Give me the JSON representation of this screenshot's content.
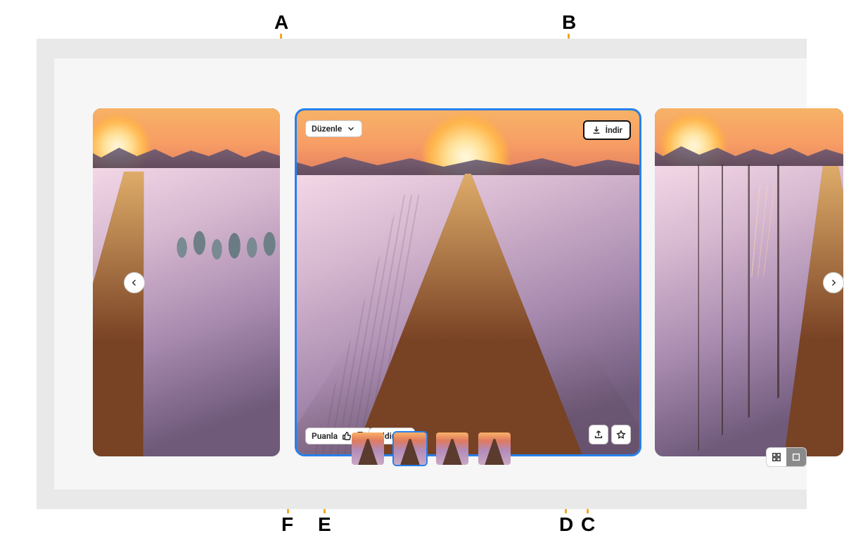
{
  "annotations": {
    "A": "A",
    "B": "B",
    "C": "C",
    "D": "D",
    "E": "E",
    "F": "F"
  },
  "toolbar": {
    "edit_label": "Düzenle",
    "download_label": "İndir",
    "rate_label": "Puanla",
    "report_label": "Bildir"
  },
  "thumbnails": {
    "count": 4,
    "selected_index": 1
  },
  "view_modes": {
    "grid_active": false,
    "single_active": true
  }
}
